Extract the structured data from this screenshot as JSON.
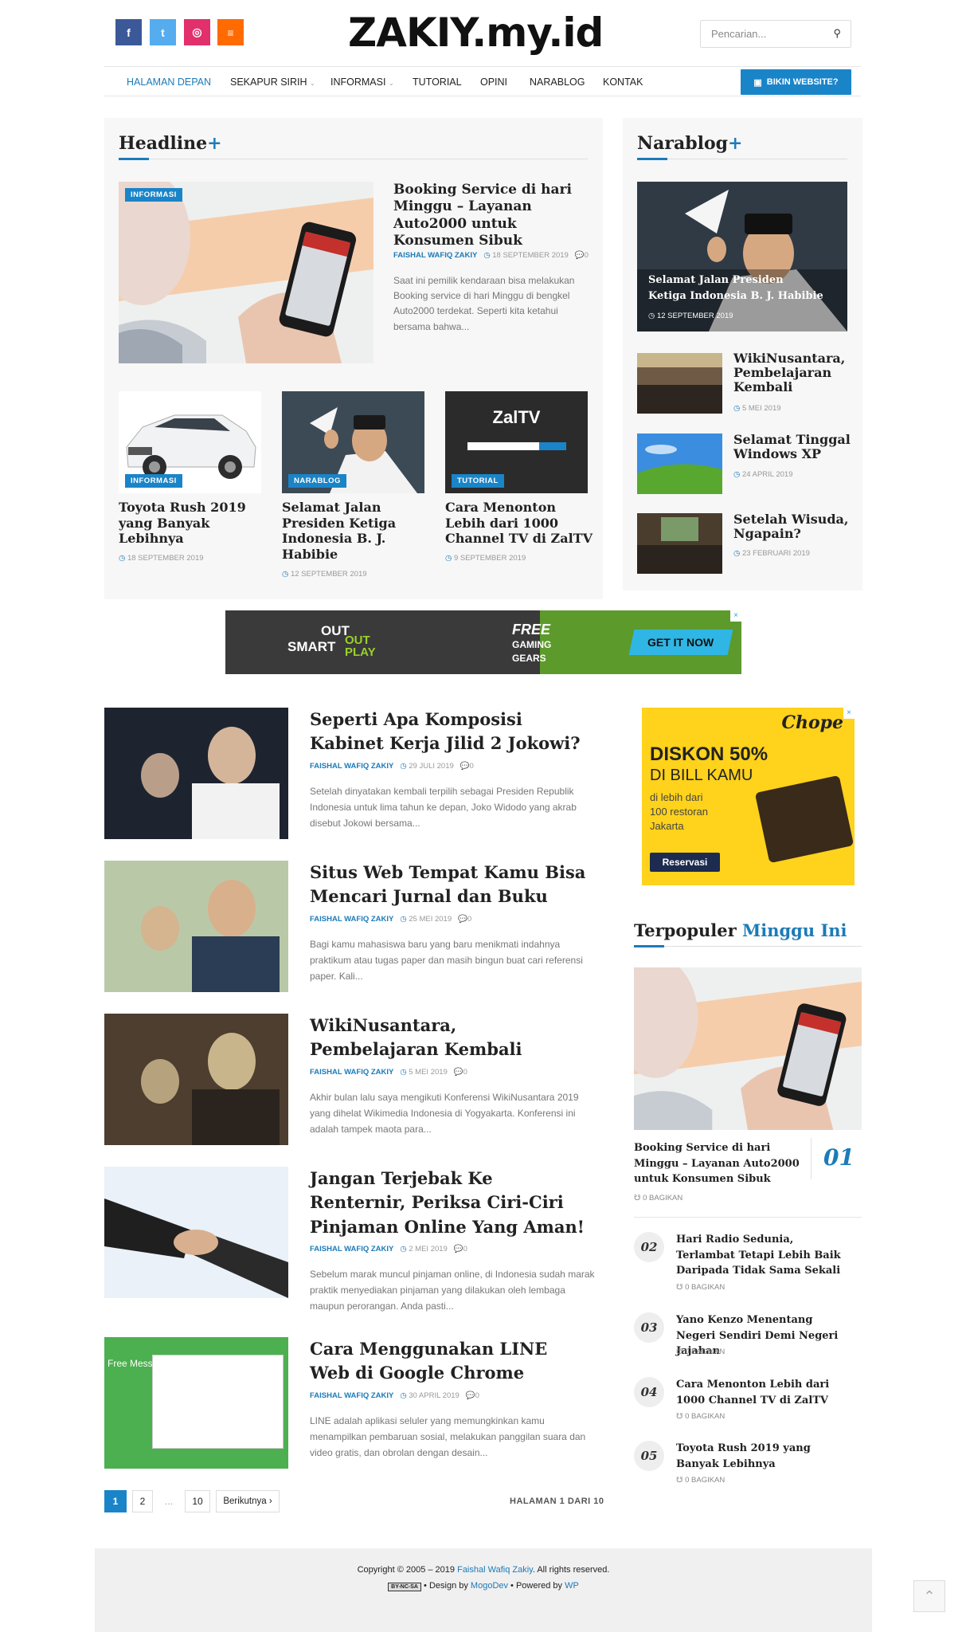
{
  "site": {
    "logo": "ZAKIY.my.id"
  },
  "social": [
    {
      "icon": "facebook-icon",
      "glyph": "f",
      "color": "#3b5998"
    },
    {
      "icon": "twitter-icon",
      "glyph": "t",
      "color": "#55acee"
    },
    {
      "icon": "instagram-icon",
      "glyph": "◎",
      "color": "#e1306c"
    },
    {
      "icon": "rss-icon",
      "glyph": "≡",
      "color": "#ff6b00"
    }
  ],
  "search": {
    "placeholder": "Pencarian..."
  },
  "nav": {
    "items": [
      "HALAMAN DEPAN",
      "SEKAPUR SIRIH",
      "INFORMASI",
      "TUTORIAL",
      "OPINI",
      "NARABLOG",
      "KONTAK"
    ],
    "cta": "BIKIN WEBSITE?"
  },
  "headline": {
    "title": "Headline",
    "plus": "+",
    "main": {
      "badge": "INFORMASI",
      "title": "Booking Service di hari Minggu – Layanan Auto2000 untuk Konsumen Sibuk",
      "author": "FAISHAL WAFIQ ZAKIY",
      "date": "18 SEPTEMBER 2019",
      "comments": "0",
      "excerpt": "Saat ini pemilik kendaraan bisa melakukan Booking service di hari Minggu di bengkel Auto2000 terdekat. Seperti kita ketahui bersama bahwa..."
    },
    "cards": [
      {
        "badge": "INFORMASI",
        "title": "Toyota Rush 2019 yang Banyak Lebihnya",
        "date": "18 SEPTEMBER 2019"
      },
      {
        "badge": "NARABLOG",
        "title": "Selamat Jalan Presiden Ketiga Indonesia B. J. Habibie",
        "date": "12 SEPTEMBER 2019"
      },
      {
        "badge": "TUTORIAL",
        "title": "Cara Menonton Lebih dari 1000 Channel TV di ZalTV",
        "date": "9 SEPTEMBER 2019"
      }
    ]
  },
  "narablog": {
    "title": "Narablog",
    "plus": "+",
    "featured": {
      "title": "Selamat Jalan Presiden Ketiga Indonesia B. J. Habibie",
      "date": "12 SEPTEMBER 2019"
    },
    "items": [
      {
        "title": "WikiNusantara, Pembelajaran Kembali",
        "date": "5 MEI 2019"
      },
      {
        "title": "Selamat Tinggal Windows XP",
        "date": "24 APRIL 2019"
      },
      {
        "title": "Setelah Wisuda, Ngapain?",
        "date": "23 FEBRUARI 2019"
      }
    ]
  },
  "ad_banner": {
    "out": "OUT",
    "smart": "SMART",
    "outplay": "OUT PLAY",
    "free": "FREE",
    "gaming": "GAMING",
    "gears": "GEARS",
    "cta": "GET IT NOW"
  },
  "ad_side": {
    "brand": "Chope",
    "headline": "DISKON 50%",
    "sub": "DI BILL KAMU",
    "text": "di lebih dari 100 restoran Jakarta",
    "cta": "Reservasi"
  },
  "posts": [
    {
      "title": "Seperti Apa Komposisi Kabinet Kerja Jilid 2 Jokowi?",
      "author": "FAISHAL WAFIQ ZAKIY",
      "date": "29 JULI 2019",
      "comments": "0",
      "excerpt": "Setelah dinyatakan kembali terpilih sebagai Presiden Republik Indonesia untuk lima tahun ke depan, Joko Widodo yang akrab disebut Jokowi bersama..."
    },
    {
      "title": "Situs Web Tempat Kamu Bisa Mencari Jurnal dan Buku",
      "author": "FAISHAL WAFIQ ZAKIY",
      "date": "25 MEI 2019",
      "comments": "0",
      "excerpt": "Bagi kamu mahasiswa baru yang baru menikmati indahnya praktikum atau tugas paper dan masih bingun buat cari referensi paper. Kali..."
    },
    {
      "title": "WikiNusantara, Pembelajaran Kembali",
      "author": "FAISHAL WAFIQ ZAKIY",
      "date": "5 MEI 2019",
      "comments": "0",
      "excerpt": "Akhir bulan lalu saya mengikuti Konferensi WikiNusantara 2019 yang dihelat Wikimedia Indonesia di Yogyakarta. Konferensi ini adalah tampek maota para..."
    },
    {
      "title": "Jangan Terjebak Ke Renternir, Periksa Ciri-Ciri Pinjaman Online Yang Aman!",
      "author": "FAISHAL WAFIQ ZAKIY",
      "date": "2 MEI 2019",
      "comments": "0",
      "excerpt": "Sebelum marak muncul pinjaman online, di Indonesia sudah marak praktik menyediakan pinjaman yang dilakukan oleh lembaga maupun perorangan. Anda pasti..."
    },
    {
      "title": "Cara Menggunakan LINE Web di Google Chrome",
      "author": "FAISHAL WAFIQ ZAKIY",
      "date": "30 APRIL 2019",
      "comments": "0",
      "excerpt": "LINE adalah aplikasi seluler yang memungkinkan kamu menampilkan pembaruan sosial, melakukan panggilan suara dan video gratis, dan obrolan dengan desain..."
    }
  ],
  "post_thumb_text": {
    "line_free": "Free Messaging"
  },
  "popular": {
    "title": "Terpopuler",
    "title_accent": "Minggu Ini",
    "first": {
      "num": "01",
      "title": "Booking Service di hari Minggu – Layanan Auto2000 untuk Konsumen Sibuk",
      "shares": "0 BAGIKAN"
    },
    "items": [
      {
        "num": "02",
        "title": "Hari Radio Sedunia, Terlambat Tetapi Lebih Baik Daripada Tidak Sama Sekali",
        "shares": "0 BAGIKAN"
      },
      {
        "num": "03",
        "title": "Yano Kenzo Menentang Negeri Sendiri Demi Negeri Jajahan",
        "shares": "0 BAGIKAN"
      },
      {
        "num": "04",
        "title": "Cara Menonton Lebih dari 1000 Channel TV di ZalTV",
        "shares": "0 BAGIKAN"
      },
      {
        "num": "05",
        "title": "Toyota Rush 2019 yang Banyak Lebihnya",
        "shares": "0 BAGIKAN"
      }
    ]
  },
  "pagination": {
    "pages": [
      "1",
      "2",
      "...",
      "10"
    ],
    "next": "Berikutnya ›",
    "status": "HALAMAN 1 DARI 10"
  },
  "footer": {
    "copyright_prefix": "Copyright © 2005 – 2019 ",
    "author_link": "Faishal Wafiq Zakiy",
    "copyright_suffix": ". All rights reserved.",
    "license": "BY-NC-SA",
    "design_prefix": " • Design by ",
    "design_link": "MogoDev",
    "powered_prefix": " • Powered by ",
    "powered_link": "WP"
  },
  "zaltv": {
    "logo": "ZalTV"
  }
}
